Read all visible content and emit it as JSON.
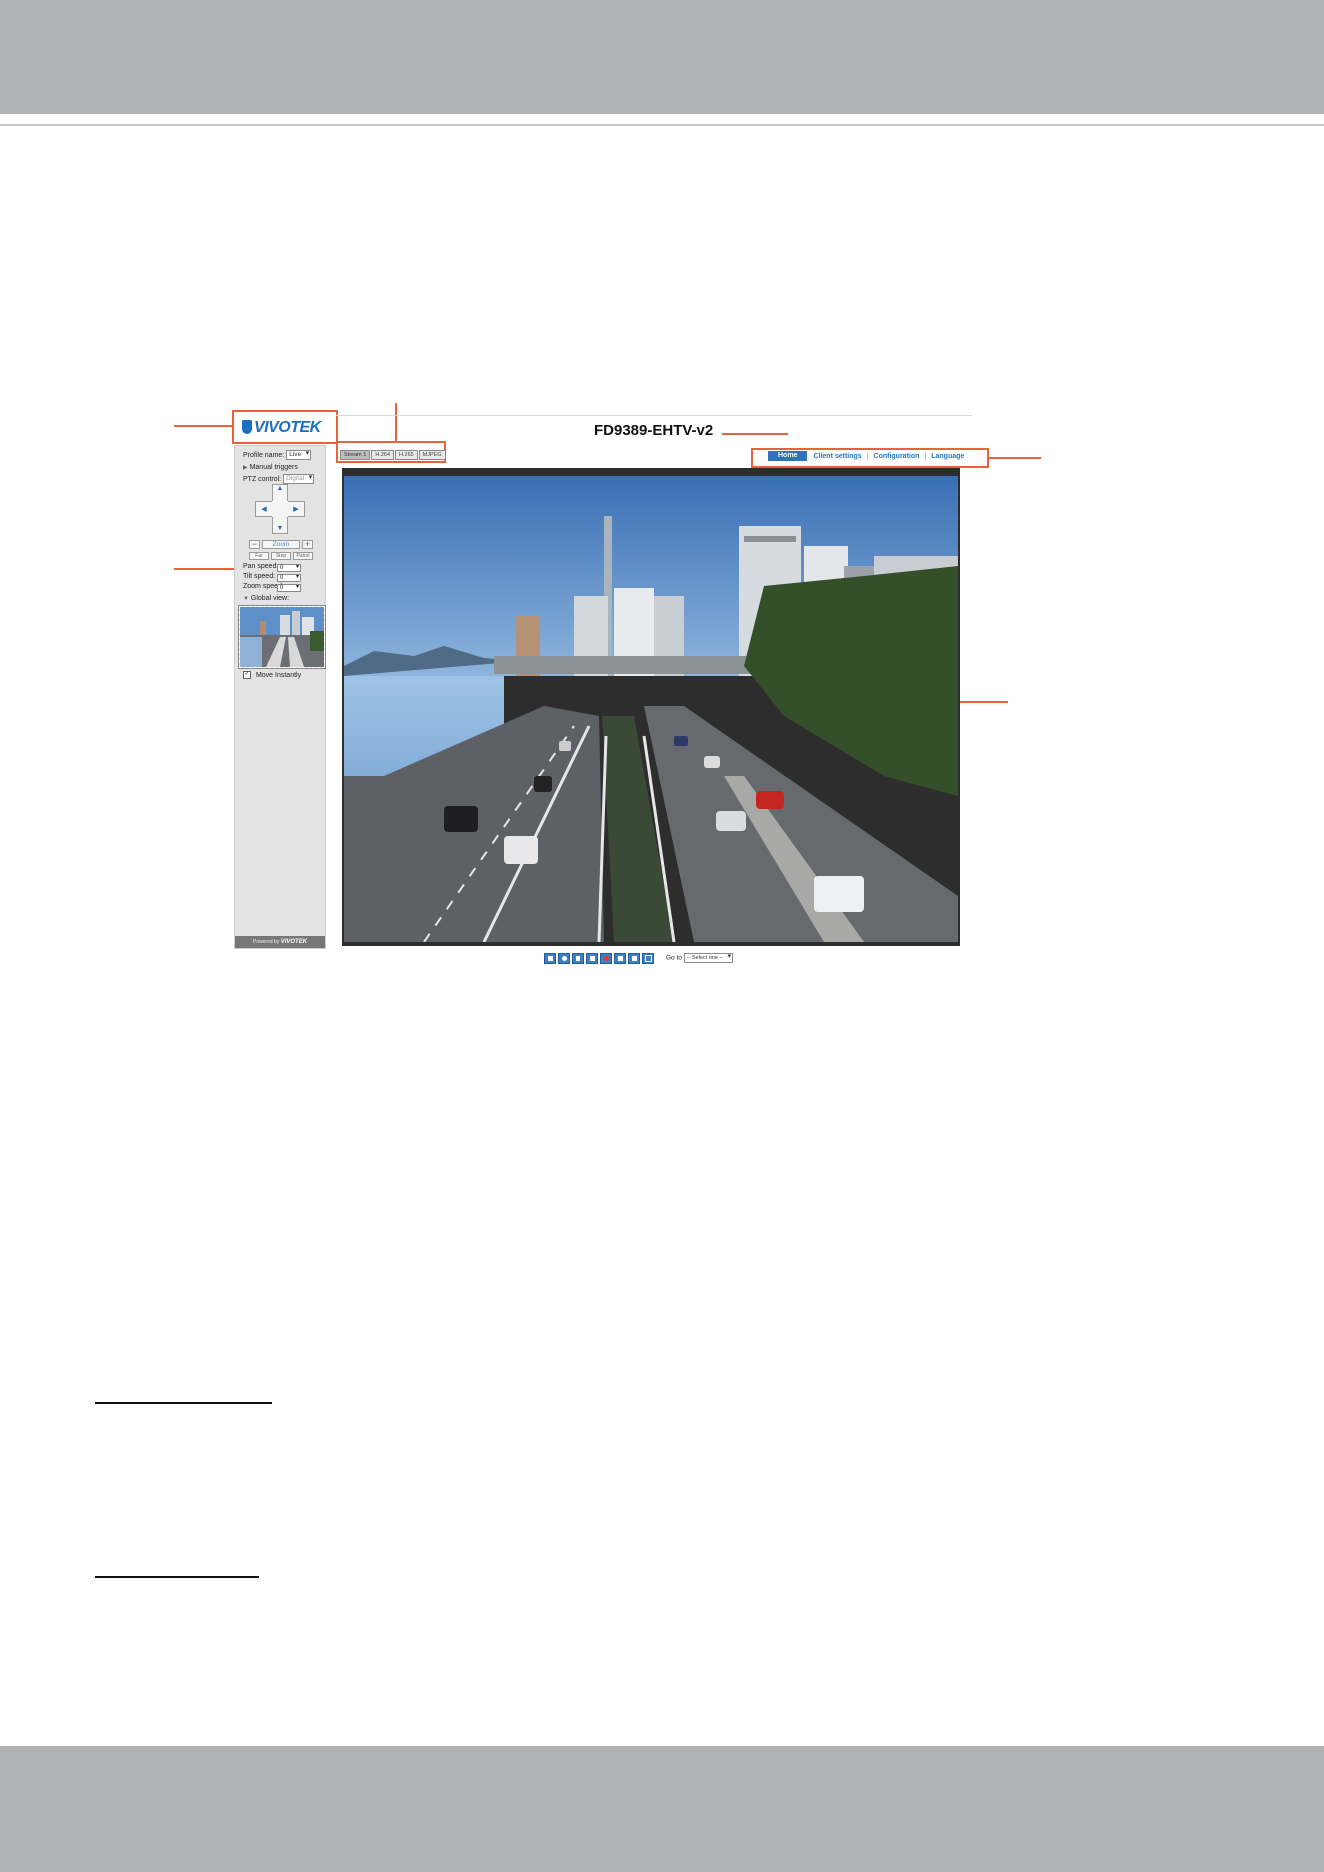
{
  "figure": {
    "title": "FD9389-EHTV-v2",
    "logo_text": "VIVOTEK",
    "sidebar": {
      "profile_label": "Profile name:",
      "profile_value": "Live",
      "manual_triggers": "Manual triggers",
      "ptz_label": "PTZ control:",
      "ptz_value": "Digital",
      "zoom_label": "Zoom",
      "zoom_minus": "−",
      "zoom_plus": "+",
      "small_buttons": [
        "Far",
        "Stop",
        "Patrol"
      ],
      "pan_speed_label": "Pan speed:",
      "pan_speed_value": "0",
      "tilt_speed_label": "Tilt speed:",
      "tilt_speed_value": "0",
      "zoom_speed_label": "Zoom speed:",
      "zoom_speed_value": "0",
      "global_view_label": "Global view:",
      "move_instantly_label": "Move Instantly",
      "move_instantly_checked": true,
      "powered_prefix": "Powered by",
      "powered_brand": "VIVOTEK"
    },
    "stream_tabs": [
      "Stream 1",
      "H.264",
      "H.265",
      "MJPEG"
    ],
    "nav": {
      "home": "Home",
      "client_settings": "Client settings",
      "configuration": "Configuration",
      "language": "Language"
    },
    "controls": {
      "buttons": [
        "snapshot-icon",
        "digital-zoom-icon",
        "pause-icon",
        "stop-icon",
        "record-icon",
        "volume-icon",
        "mute-icon",
        "fullscreen-icon"
      ],
      "goto_label": "Go to",
      "goto_value": "-- Select one --"
    }
  },
  "colors": {
    "callout": "#e8623a",
    "brand_blue": "#1b6fc2",
    "nav_blue": "#2e74b8",
    "doc_band": "#b0b1b3"
  }
}
